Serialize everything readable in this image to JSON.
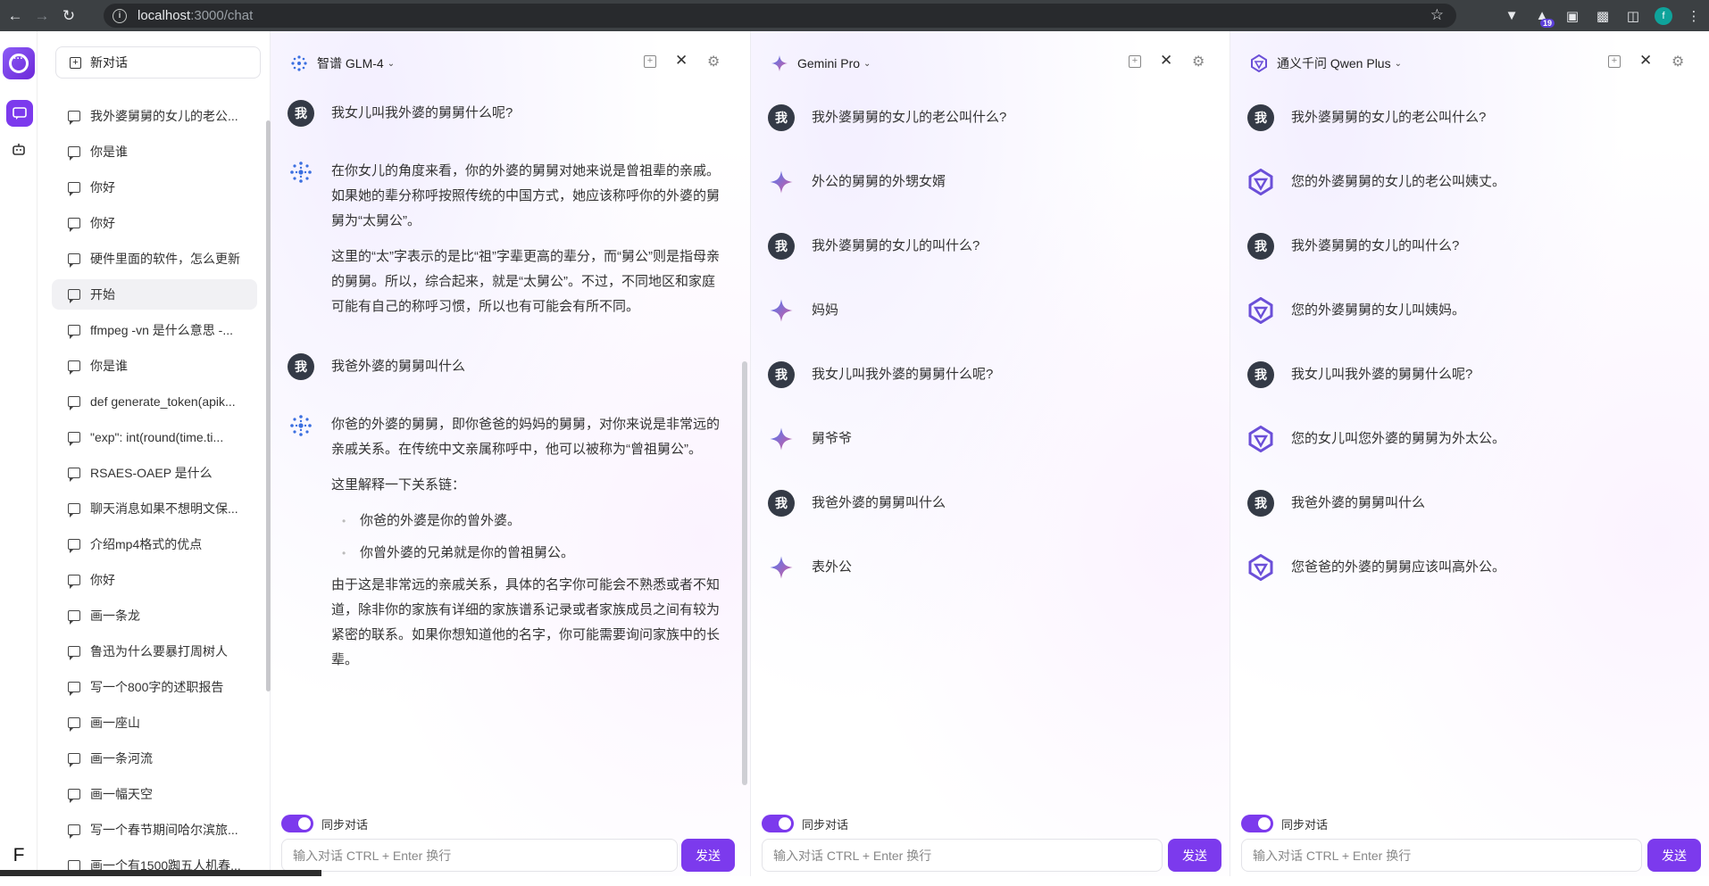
{
  "browser": {
    "url_host": "localhost",
    "url_path": ":3000/chat",
    "ext_badge": "19",
    "profile_letter": "f"
  },
  "rail": {
    "user_initial": "F"
  },
  "sidebar": {
    "new_chat_label": "新对话",
    "conversations": [
      {
        "label": "我外婆舅舅的女儿的老公..."
      },
      {
        "label": "你是谁"
      },
      {
        "label": "你好"
      },
      {
        "label": "你好"
      },
      {
        "label": "硬件里面的软件，怎么更新"
      },
      {
        "label": "开始"
      },
      {
        "label": "ffmpeg -vn 是什么意思 -..."
      },
      {
        "label": "你是谁"
      },
      {
        "label": "def generate_token(apik..."
      },
      {
        "label": "\"exp\": int(round(time.ti..."
      },
      {
        "label": "RSAES-OAEP 是什么"
      },
      {
        "label": "聊天消息如果不想明文保..."
      },
      {
        "label": "介绍mp4格式的优点"
      },
      {
        "label": "你好"
      },
      {
        "label": "画一条龙"
      },
      {
        "label": "鲁迅为什么要暴打周树人"
      },
      {
        "label": "写一个800字的述职报告"
      },
      {
        "label": "画一座山"
      },
      {
        "label": "画一条河流"
      },
      {
        "label": "画一幅天空"
      },
      {
        "label": "写一个春节期间哈尔滨旅..."
      },
      {
        "label": "画一个有1500踟五人机春..."
      }
    ]
  },
  "user_avatar_char": "我",
  "footer": {
    "sync_label": "同步对话",
    "input_placeholder": "输入对话 CTRL + Enter 换行",
    "send_label": "发送"
  },
  "panels": {
    "glm": {
      "model_name": "智谱 GLM-4",
      "messages": [
        {
          "role": "user",
          "text": "我女儿叫我外婆的舅舅什么呢?"
        },
        {
          "role": "bot",
          "p1": "在你女儿的角度来看，你的外婆的舅舅对她来说是曾祖辈的亲戚。如果她的辈分称呼按照传统的中国方式，她应该称呼你的外婆的舅舅为“太舅公”。",
          "p2": "这里的“太”字表示的是比“祖”字辈更高的辈分，而“舅公”则是指母亲的舅舅。所以，综合起来，就是“太舅公”。不过，不同地区和家庭可能有自己的称呼习惯，所以也有可能会有所不同。"
        },
        {
          "role": "user",
          "text": "我爸外婆的舅舅叫什么"
        },
        {
          "role": "bot",
          "p1": "你爸的外婆的舅舅，即你爸爸的妈妈的舅舅，对你来说是非常远的亲戚关系。在传统中文亲属称呼中，他可以被称为“曾祖舅公”。",
          "p2": "这里解释一下关系链：",
          "li1": "你爸的外婆是你的曾外婆。",
          "li2": "你曾外婆的兄弟就是你的曾祖舅公。",
          "p3": "由于这是非常远的亲戚关系，具体的名字你可能会不熟悉或者不知道，除非你的家族有详细的家族谱系记录或者家族成员之间有较为紧密的联系。如果你想知道他的名字，你可能需要询问家族中的长辈。"
        }
      ]
    },
    "gemini": {
      "model_name": "Gemini Pro",
      "messages": [
        {
          "role": "user",
          "text": "我外婆舅舅的女儿的老公叫什么?"
        },
        {
          "role": "bot",
          "text": "外公的舅舅的外甥女婿"
        },
        {
          "role": "user",
          "text": "我外婆舅舅的女儿的叫什么?"
        },
        {
          "role": "bot",
          "text": "妈妈"
        },
        {
          "role": "user",
          "text": "我女儿叫我外婆的舅舅什么呢?"
        },
        {
          "role": "bot",
          "text": "舅爷爷"
        },
        {
          "role": "user",
          "text": "我爸外婆的舅舅叫什么"
        },
        {
          "role": "bot",
          "text": "表外公"
        }
      ]
    },
    "qwen": {
      "model_name": "通义千问 Qwen Plus",
      "messages": [
        {
          "role": "user",
          "text": "我外婆舅舅的女儿的老公叫什么?"
        },
        {
          "role": "bot",
          "text": "您的外婆舅舅的女儿的老公叫姨丈。"
        },
        {
          "role": "user",
          "text": "我外婆舅舅的女儿的叫什么?"
        },
        {
          "role": "bot",
          "text": "您的外婆舅舅的女儿叫姨妈。"
        },
        {
          "role": "user",
          "text": "我女儿叫我外婆的舅舅什么呢?"
        },
        {
          "role": "bot",
          "text": "您的女儿叫您外婆的舅舅为外太公。"
        },
        {
          "role": "user",
          "text": "我爸外婆的舅舅叫什么"
        },
        {
          "role": "bot",
          "text": "您爸爸的外婆的舅舅应该叫高外公。"
        }
      ]
    }
  },
  "colors": {
    "accent": "#7c3aed",
    "user_avatar_bg": "#343a46"
  }
}
